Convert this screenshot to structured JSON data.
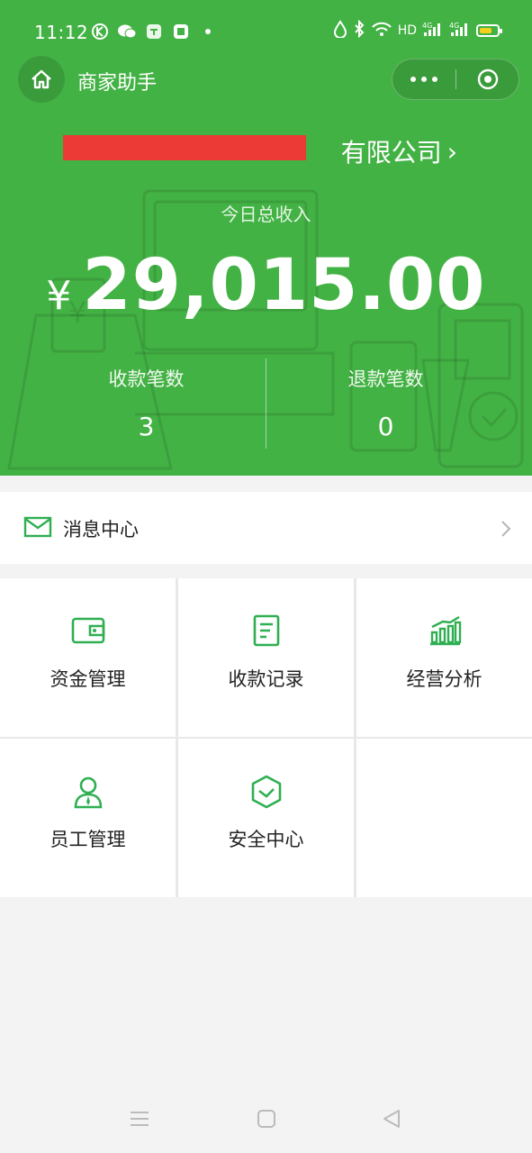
{
  "status_bar": {
    "time": "11:12",
    "network": "HD"
  },
  "navbar": {
    "title": "商家助手"
  },
  "merchant": {
    "company_suffix": "有限公司",
    "chevron": "›"
  },
  "income": {
    "label": "今日总收入",
    "currency": "¥",
    "amount": "29,015.00"
  },
  "stats": [
    {
      "label": "收款笔数",
      "value": "3"
    },
    {
      "label": "退款笔数",
      "value": "0"
    }
  ],
  "message_center": {
    "label": "消息中心"
  },
  "menu": [
    {
      "label": "资金管理",
      "icon": "wallet-icon"
    },
    {
      "label": "收款记录",
      "icon": "receipt-icon"
    },
    {
      "label": "经营分析",
      "icon": "bar-chart-icon"
    },
    {
      "label": "员工管理",
      "icon": "staff-icon"
    },
    {
      "label": "安全中心",
      "icon": "shield-icon"
    }
  ],
  "colors": {
    "brand_green": "#43b244",
    "icon_green": "#2faf52",
    "redaction": "#ec3a37"
  }
}
